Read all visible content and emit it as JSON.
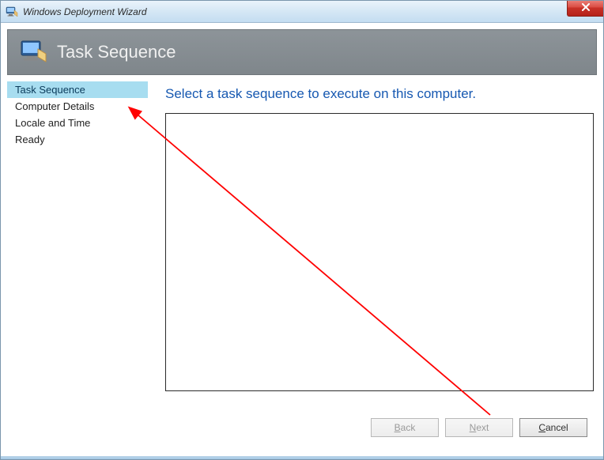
{
  "window": {
    "title": "Windows Deployment Wizard"
  },
  "header": {
    "title": "Task Sequence"
  },
  "sidebar": {
    "items": [
      {
        "label": "Task Sequence",
        "selected": true
      },
      {
        "label": "Computer Details",
        "selected": false
      },
      {
        "label": "Locale and Time",
        "selected": false
      },
      {
        "label": "Ready",
        "selected": false
      }
    ]
  },
  "main": {
    "heading": "Select a task sequence to execute on this computer."
  },
  "buttons": {
    "back": "Back",
    "next": "Next",
    "cancel": "Cancel"
  }
}
